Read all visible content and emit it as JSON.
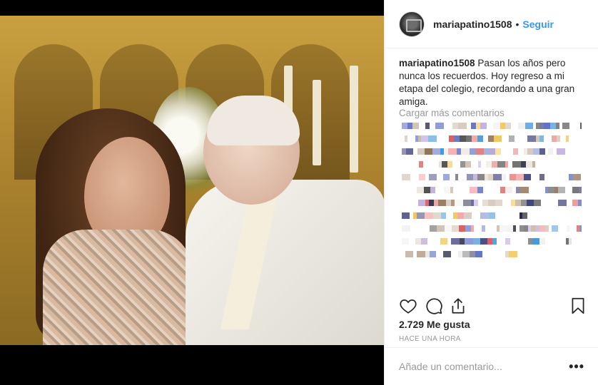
{
  "post": {
    "username": "mariapatino1508",
    "follow_label": "Seguir",
    "separator": "•",
    "caption_user": "mariapatino1508",
    "caption_text": " Pasan los años pero nunca los recuerdos. Hoy regreso a mi etapa del colegio, recordando a una gran amiga.",
    "load_more_comments": "Cargar más comentarios",
    "likes": "2.729 Me gusta",
    "timestamp": "HACE UNA HORA",
    "comment_placeholder": "Añade un comentario...",
    "more_label": "•••"
  },
  "icons": {
    "avatar": "profile-avatar",
    "like": "heart-icon",
    "comment": "comment-icon",
    "share": "share-icon",
    "save": "bookmark-icon",
    "more": "more-options-icon"
  },
  "colors": {
    "accent": "#3897f0",
    "muted": "#999999",
    "text": "#262626",
    "divider": "#efefef"
  }
}
